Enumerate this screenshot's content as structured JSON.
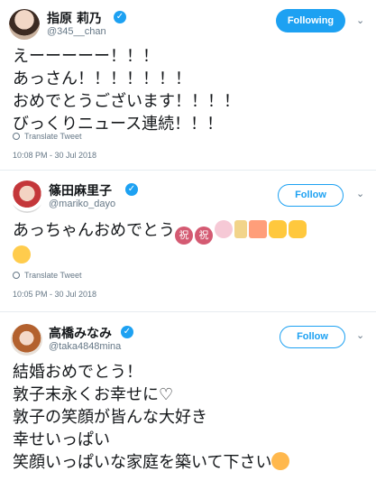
{
  "tweets": [
    {
      "display_name": "指原 莉乃",
      "handle": "@345__chan",
      "follow_label": "Following",
      "lines": [
        "えーーーーー！！！",
        "あっさん！！！！！！！",
        "おめでとうございます！！！！",
        "びっくりニュース連続！！！"
      ],
      "translate": "Translate Tweet",
      "timestamp": "10:08 PM - 30 Jul 2018"
    },
    {
      "display_name": "篠田麻里子",
      "handle": "@mariko_dayo",
      "follow_label": "Follow",
      "lines": [
        "あっちゃんおめでとう"
      ],
      "emoji_line1": [
        "祝-emoji",
        "祝-emoji",
        "cherry-blossom-emoji",
        "champagne-emoji",
        "party-popper-emoji",
        "thumbs-up-emoji",
        "thumbs-up-emoji"
      ],
      "emoji_line2": [
        "smiling-face-emoji"
      ],
      "iwai_char": "祝",
      "translate": "Translate Tweet",
      "timestamp": "10:05 PM - 30 Jul 2018"
    },
    {
      "display_name": "高橋みなみ",
      "handle": "@taka4848mina",
      "follow_label": "Follow",
      "lines": [
        "結婚おめでとう！",
        "敦子末永くお幸せに♡",
        "敦子の笑顔が皆んな大好き",
        "幸せいっぱい",
        "笑顔いっぱいな家庭を築いて下さい"
      ],
      "emoji_end": "blushing-face-emoji"
    }
  ],
  "colors": {
    "accent": "#1da1f2",
    "text": "#14171a",
    "muted": "#657786"
  }
}
